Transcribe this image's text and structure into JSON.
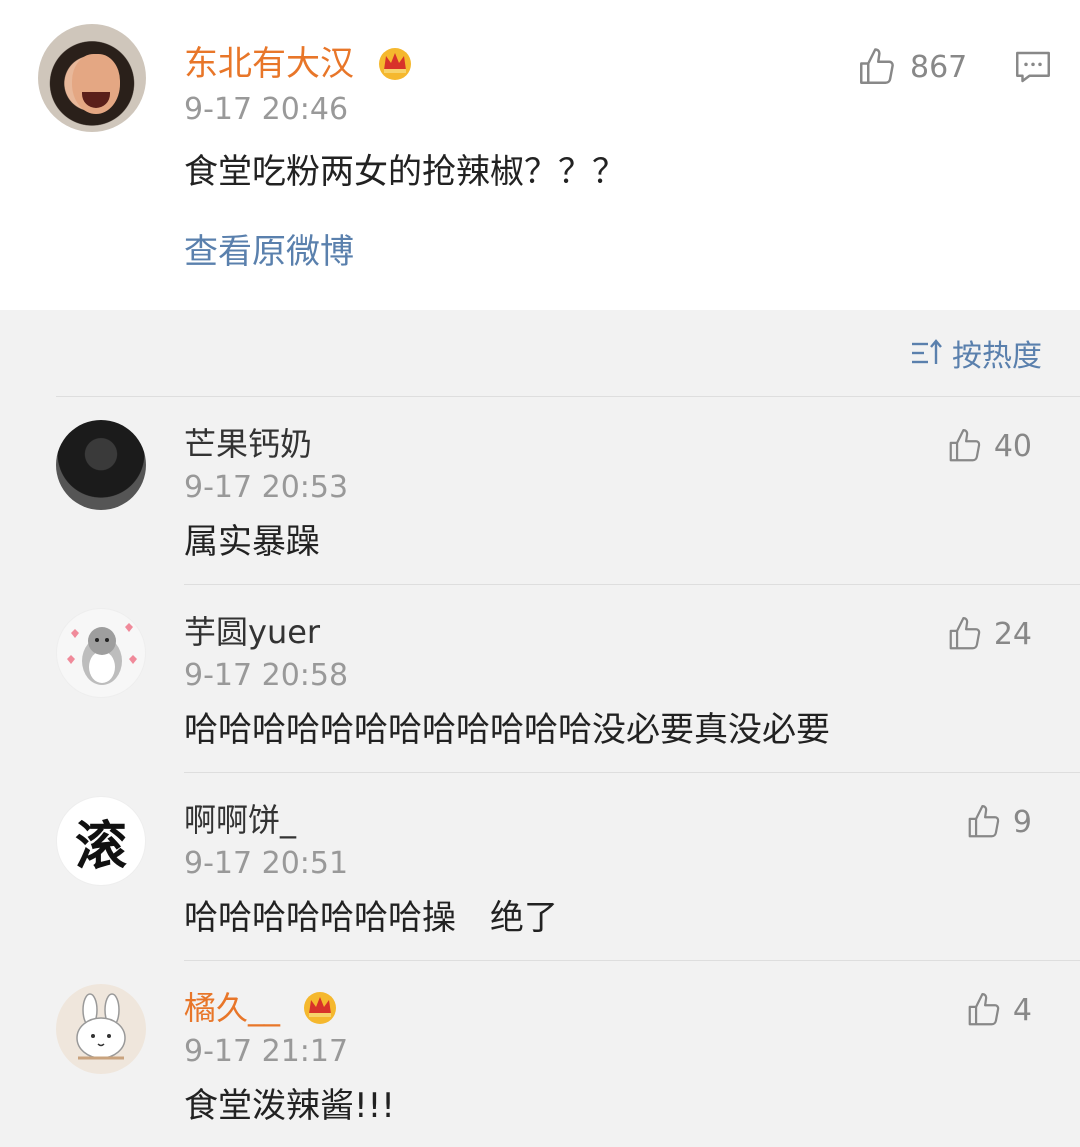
{
  "post": {
    "author": "东北有大汉",
    "time": "9-17 20:46",
    "text": "食堂吃粉两女的抢辣椒？？？",
    "view_original": "查看原微博",
    "likes": "867",
    "author_color": "#e87629",
    "link_color": "#5a80ad"
  },
  "sort": {
    "label": "按热度"
  },
  "comments": [
    {
      "name": "芒果钙奶",
      "time": "9-17 20:53",
      "text": "属实暴躁",
      "likes": "40"
    },
    {
      "name": "芋圆yuer",
      "time": "9-17 20:58",
      "text": "哈哈哈哈哈哈哈哈哈哈哈哈没必要真没必要",
      "likes": "24"
    },
    {
      "name": "啊啊饼_",
      "time": "9-17 20:51",
      "text": "哈哈哈哈哈哈哈操　绝了",
      "likes": "9",
      "avatar_glyph": "滚"
    },
    {
      "name": "橘久__",
      "time": "9-17 21:17",
      "text": "食堂泼辣酱!!!",
      "likes": "4"
    }
  ],
  "icons": {
    "like": "thumbs-up-icon",
    "comment": "comment-icon",
    "sort": "sort-icon",
    "vip": "crown-icon"
  }
}
